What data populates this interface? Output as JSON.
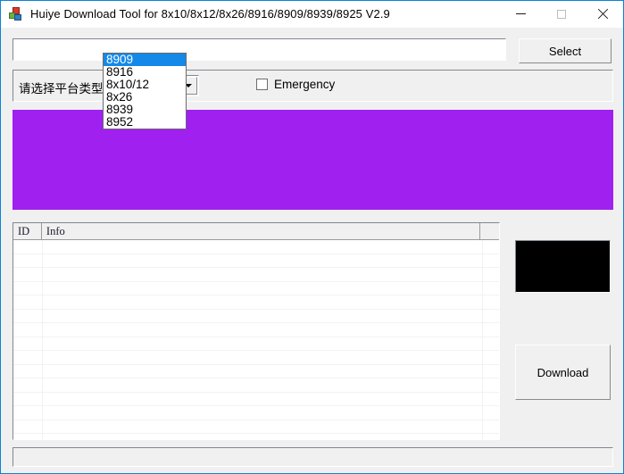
{
  "window": {
    "title": "Huiye Download Tool for 8x10/8x12/8x26/8916/8909/8939/8925 V2.9",
    "icon": "app-blocks-icon",
    "controls": {
      "minimize": "—",
      "maximize": "□",
      "close": "✕"
    },
    "border_color": "#0a84d8"
  },
  "toolbar": {
    "path_value": "",
    "path_placeholder": "",
    "select_label": "Select"
  },
  "platform": {
    "label": "请选择平台类型：",
    "selected": "8909",
    "dropdown_open": true,
    "options": [
      {
        "label": "8909",
        "selected": true
      },
      {
        "label": "8916",
        "selected": false
      },
      {
        "label": "8x10/12",
        "selected": false
      },
      {
        "label": "8x26",
        "selected": false
      },
      {
        "label": "8939",
        "selected": false
      },
      {
        "label": "8952",
        "selected": false
      }
    ],
    "highlight_color": "#1589e8"
  },
  "emergency": {
    "label": "Emergency",
    "checked": false
  },
  "video_area": {
    "color": "#a020f0"
  },
  "list": {
    "columns": [
      "ID",
      "Info"
    ],
    "rows": []
  },
  "preview": {
    "color": "#000000"
  },
  "actions": {
    "download_label": "Download"
  },
  "status": {
    "text": ""
  }
}
